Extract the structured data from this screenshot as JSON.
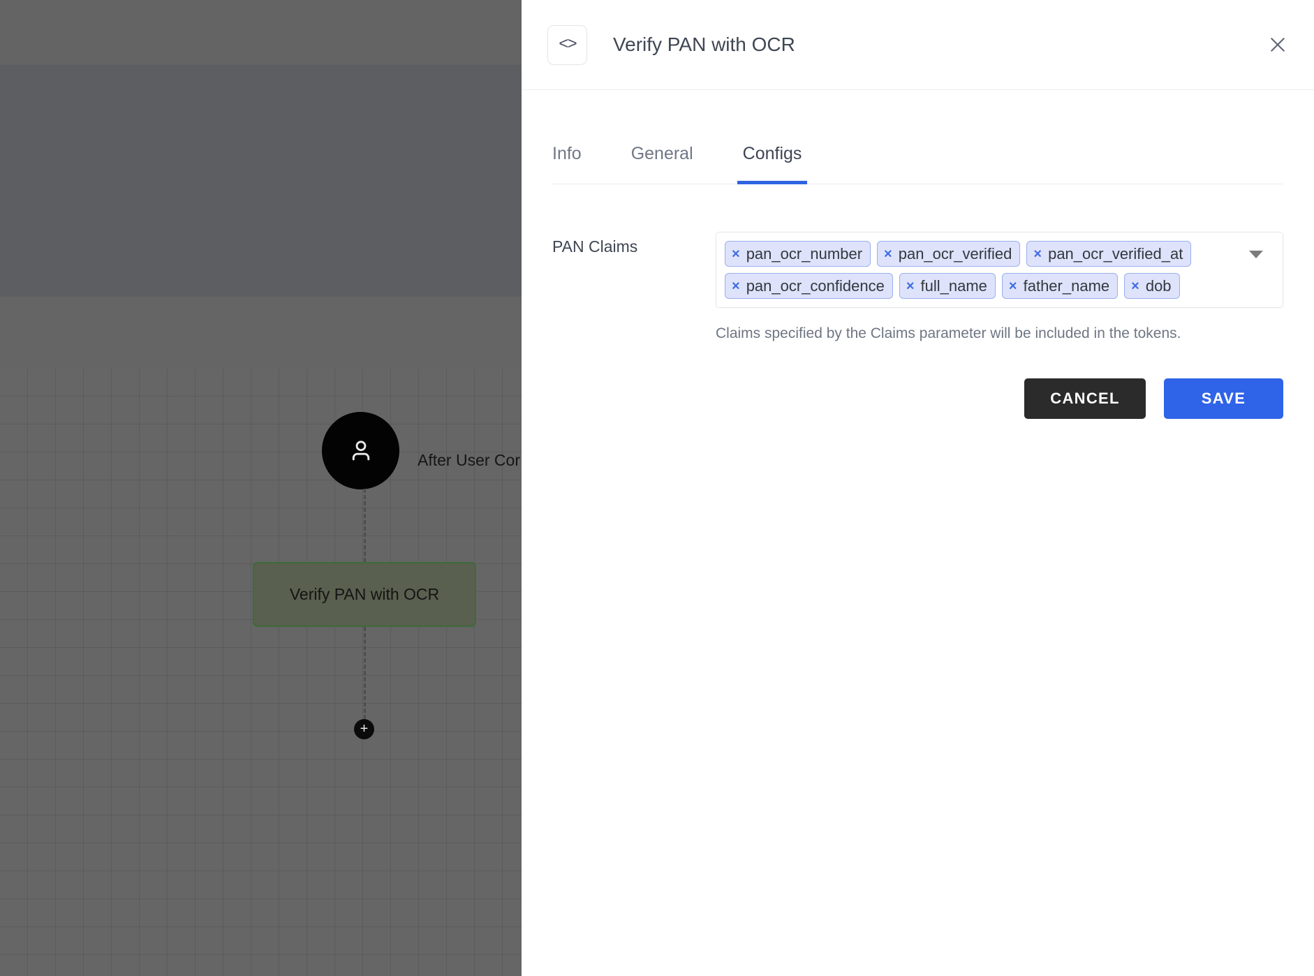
{
  "canvas": {
    "start_node": {
      "icon": "user-icon",
      "label": "After User Cor"
    },
    "step_node": {
      "label": "Verify PAN with OCR"
    },
    "add_button": {
      "label": "+"
    }
  },
  "panel": {
    "header": {
      "icon": "code-brackets-icon",
      "icon_glyph": "<>",
      "title": "Verify PAN with OCR",
      "close_icon": "close-icon"
    },
    "tabs": [
      {
        "label": "Info",
        "active": false
      },
      {
        "label": "General",
        "active": false
      },
      {
        "label": "Configs",
        "active": true
      }
    ],
    "field": {
      "label": "PAN Claims",
      "chips": [
        "pan_ocr_number",
        "pan_ocr_verified",
        "pan_ocr_verified_at",
        "pan_ocr_confidence",
        "full_name",
        "father_name",
        "dob"
      ],
      "chip_remove_glyph": "×",
      "dropdown_icon": "chevron-down-icon",
      "helper_text": "Claims specified by the Claims parameter will be included in the tokens."
    },
    "buttons": {
      "cancel": "CANCEL",
      "save": "SAVE"
    }
  },
  "colors": {
    "accent_blue": "#2f63e8",
    "cancel_dark": "#2b2b2b",
    "chip_bg": "#dee3fb",
    "chip_border": "#9aafee",
    "chip_x": "#3f6ce4",
    "node_border_green": "#3d6b39",
    "canvas_gray": "#666666"
  }
}
